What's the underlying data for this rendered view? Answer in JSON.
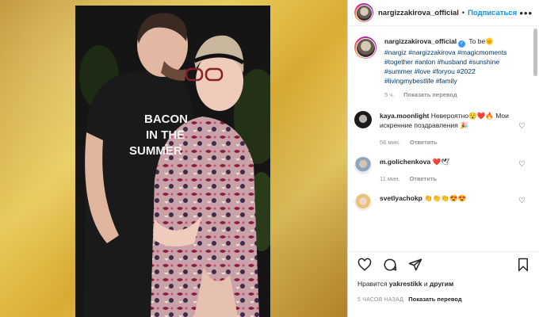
{
  "header": {
    "username": "nargizzakirova_official",
    "separator": "•",
    "follow_label": "Подписаться",
    "more_icon": "more-horizontal-icon"
  },
  "caption": {
    "username": "nargizzakirova_official",
    "text": "To be🌞",
    "hashtags": "#nargiz #nargizzakirova #magicmoments #together #anton #husband #sunshine #summer #love #foryou #2022 #livingmybestlife #family",
    "time": "5 ч.",
    "translate": "Показать перевод"
  },
  "comments": [
    {
      "username": "kaya.moonlight",
      "text": "Невероятно😯❤️🔥 Мои искренние поздравления 🎉",
      "time": "56 мин.",
      "reply": "Ответить"
    },
    {
      "username": "m.golichenkova",
      "text": "❤️🕊",
      "time": "11 мин.",
      "reply": "Ответить"
    },
    {
      "username": "svetlyachokp",
      "text": "👏👏👏😍😍"
    }
  ],
  "photo_shirt_text": [
    "BACON",
    "IN THE",
    "SUMMER"
  ],
  "likes": {
    "prefix": "Нравится",
    "user1": "yakrestikk",
    "conj": "и",
    "user2": "другим"
  },
  "footer": {
    "time": "5 часов назад",
    "translate": "Показать перевод"
  },
  "colors": {
    "accent": "#0095f6",
    "hashtag": "#00376b",
    "muted": "#8e8e8e"
  }
}
